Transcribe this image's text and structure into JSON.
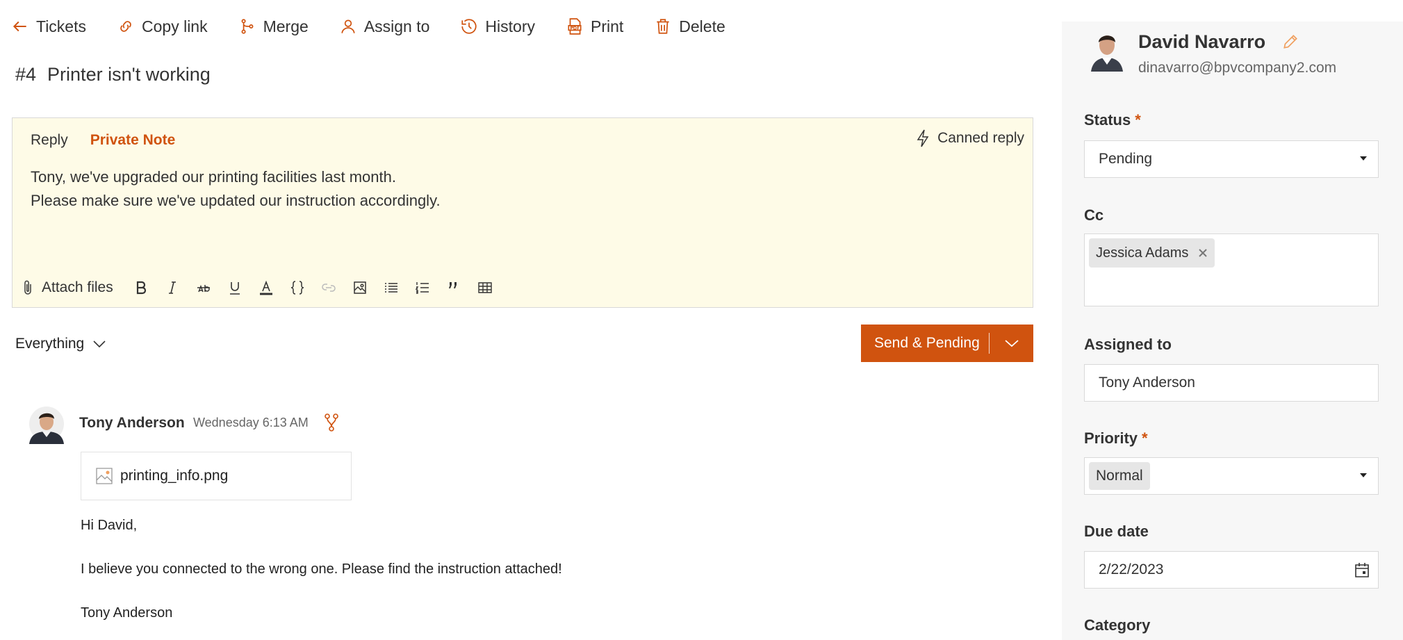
{
  "toolbar": {
    "tickets": "Tickets",
    "copy_link": "Copy link",
    "merge": "Merge",
    "assign_to": "Assign to",
    "history": "History",
    "print": "Print",
    "delete": "Delete"
  },
  "ticket": {
    "number": "#4",
    "subject": "Printer isn't working"
  },
  "editor": {
    "tab_reply": "Reply",
    "tab_private_note": "Private Note",
    "canned_reply": "Canned reply",
    "line1": "Tony, we've upgraded our printing facilities last month.",
    "line2": "Please make sure we've updated our instruction accordingly.",
    "attach_files": "Attach files"
  },
  "filter": {
    "label": "Everything"
  },
  "send_button": {
    "label": "Send & Pending"
  },
  "message": {
    "author": "Tony Anderson",
    "time": "Wednesday 6:13 AM",
    "attachment": "printing_info.png",
    "greeting": "Hi David,",
    "body": "I believe you connected to the wrong one. Please find the instruction attached!",
    "signature": "Tony Anderson"
  },
  "sidebar": {
    "contact_name": "David Navarro",
    "contact_email": "dinavarro@bpvcompany2.com",
    "status_label": "Status",
    "status_value": "Pending",
    "cc_label": "Cc",
    "cc_chip": "Jessica Adams",
    "assigned_label": "Assigned to",
    "assigned_value": "Tony Anderson",
    "priority_label": "Priority",
    "priority_value": "Normal",
    "due_label": "Due date",
    "due_value": "2/22/2023",
    "category_label": "Category",
    "required_mark": "*"
  },
  "colors": {
    "accent": "#d0530f",
    "editor_bg": "#fefbe7",
    "sidebar_bg": "#f7f7f7"
  }
}
